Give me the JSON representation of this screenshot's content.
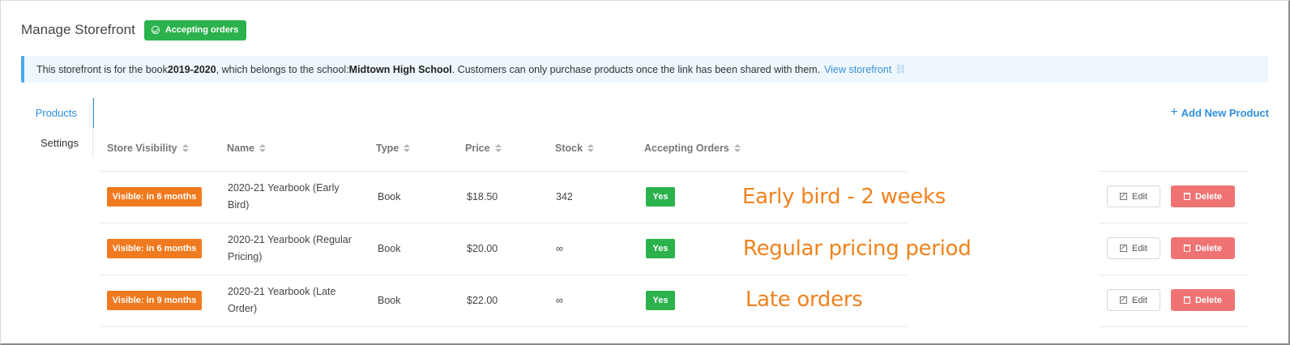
{
  "header": {
    "title": "Manage Storefront",
    "status_badge": "Accepting orders",
    "status_icon": "check-circle-icon"
  },
  "info": {
    "text_1": "This storefront is for the book ",
    "book": "2019-2020",
    "text_2": ", which belongs to the school: ",
    "school": "Midtown High School",
    "text_3": ". Customers can only purchase products once the link has been shared with them.",
    "link": "View storefront",
    "link_icon": "external-link-icon"
  },
  "sidebar": {
    "items": [
      {
        "label": "Products",
        "active": true
      },
      {
        "label": "Settings",
        "active": false
      }
    ]
  },
  "toolbar": {
    "add_label": "Add New Product",
    "add_icon": "plus-icon"
  },
  "table": {
    "headers": [
      "Store Visibility",
      "Name",
      "Type",
      "Price",
      "Stock",
      "Accepting Orders"
    ],
    "rows": [
      {
        "visibility": "Visible: in 6 months",
        "name": "2020-21 Yearbook (Early Bird)",
        "type": "Book",
        "price": "$18.50",
        "stock": "342",
        "accepting": "Yes",
        "annotation": "Early bird - 2 weeks",
        "edit": "Edit",
        "delete": "Delete"
      },
      {
        "visibility": "Visible: in 6 months",
        "name": "2020-21 Yearbook (Regular Pricing)",
        "type": "Book",
        "price": "$20.00",
        "stock": "∞",
        "accepting": "Yes",
        "annotation": "Regular pricing period",
        "edit": "Edit",
        "delete": "Delete"
      },
      {
        "visibility": "Visible: in 9 months",
        "name": "2020-21 Yearbook (Late Order)",
        "type": "Book",
        "price": "$22.00",
        "stock": "∞",
        "accepting": "Yes",
        "annotation": "Late orders",
        "edit": "Edit",
        "delete": "Delete"
      }
    ]
  },
  "colors": {
    "accent": "#2f8fe0",
    "success": "#2bb24c",
    "visibility_badge": "#f07a1f",
    "delete": "#f07373",
    "annotation": "#f0821e"
  }
}
